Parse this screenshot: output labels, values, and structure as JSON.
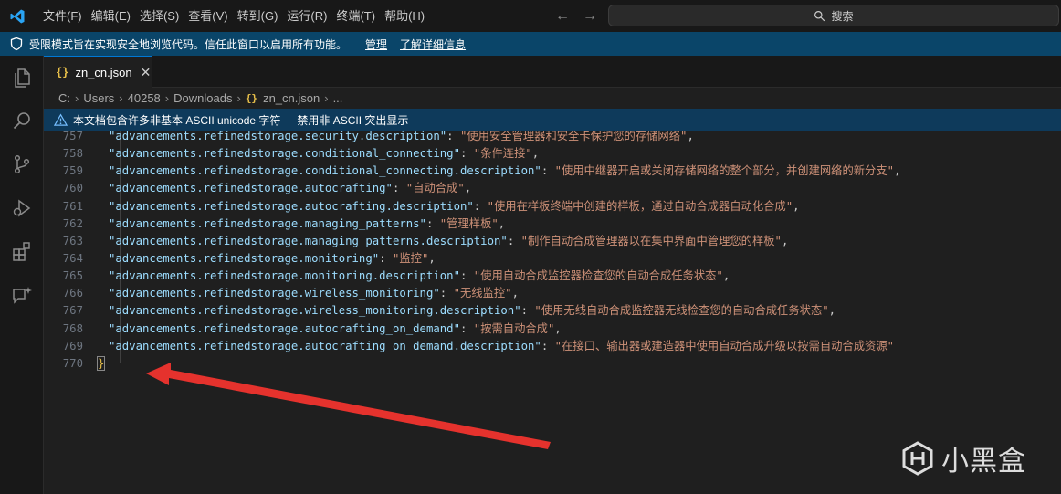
{
  "menu": [
    "文件(F)",
    "编辑(E)",
    "选择(S)",
    "查看(V)",
    "转到(G)",
    "运行(R)",
    "终端(T)",
    "帮助(H)"
  ],
  "search": {
    "label": "搜索"
  },
  "banner": {
    "text": "受限模式旨在实现安全地浏览代码。信任此窗口以启用所有功能。",
    "manage": "管理",
    "learn_more": "了解详细信息"
  },
  "tab": {
    "icon": "{}",
    "label": "zn_cn.json",
    "close": "✕"
  },
  "breadcrumb": [
    "C:",
    "Users",
    "40258",
    "Downloads",
    "zn_cn.json",
    "..."
  ],
  "breadcrumb_icon": "{}",
  "unicode_warning": {
    "text": "本文档包含许多非基本 ASCII unicode 字符",
    "action": "禁用非 ASCII 突出显示"
  },
  "code_lines": [
    {
      "num": "757",
      "key": "\"advancements.refinedstorage.security.description\"",
      "sep": ": ",
      "val": "\"使用安全管理器和安全卡保护您的存储网络\"",
      "end": ","
    },
    {
      "num": "758",
      "key": "\"advancements.refinedstorage.conditional_connecting\"",
      "sep": ": ",
      "val": "\"条件连接\"",
      "end": ","
    },
    {
      "num": "759",
      "key": "\"advancements.refinedstorage.conditional_connecting.description\"",
      "sep": ": ",
      "val": "\"使用中继器开启或关闭存储网络的整个部分，并创建网络的新分支\"",
      "end": ","
    },
    {
      "num": "760",
      "key": "\"advancements.refinedstorage.autocrafting\"",
      "sep": ": ",
      "val": "\"自动合成\"",
      "end": ","
    },
    {
      "num": "761",
      "key": "\"advancements.refinedstorage.autocrafting.description\"",
      "sep": ": ",
      "val": "\"使用在样板终端中创建的样板，通过自动合成器自动化合成\"",
      "end": ","
    },
    {
      "num": "762",
      "key": "\"advancements.refinedstorage.managing_patterns\"",
      "sep": ": ",
      "val": "\"管理样板\"",
      "end": ","
    },
    {
      "num": "763",
      "key": "\"advancements.refinedstorage.managing_patterns.description\"",
      "sep": ": ",
      "val": "\"制作自动合成管理器以在集中界面中管理您的样板\"",
      "end": ","
    },
    {
      "num": "764",
      "key": "\"advancements.refinedstorage.monitoring\"",
      "sep": ": ",
      "val": "\"监控\"",
      "end": ","
    },
    {
      "num": "765",
      "key": "\"advancements.refinedstorage.monitoring.description\"",
      "sep": ": ",
      "val": "\"使用自动合成监控器检查您的自动合成任务状态\"",
      "end": ","
    },
    {
      "num": "766",
      "key": "\"advancements.refinedstorage.wireless_monitoring\"",
      "sep": ": ",
      "val": "\"无线监控\"",
      "end": ","
    },
    {
      "num": "767",
      "key": "\"advancements.refinedstorage.wireless_monitoring.description\"",
      "sep": ": ",
      "val": "\"使用无线自动合成监控器无线检查您的自动合成任务状态\"",
      "end": ","
    },
    {
      "num": "768",
      "key": "\"advancements.refinedstorage.autocrafting_on_demand\"",
      "sep": ": ",
      "val": "\"按需自动合成\"",
      "end": ","
    },
    {
      "num": "769",
      "key": "\"advancements.refinedstorage.autocrafting_on_demand.description\"",
      "sep": ": ",
      "val": "\"在接口、输出器或建造器中使用自动合成升级以按需自动合成资源\"",
      "end": ""
    }
  ],
  "last_line": {
    "num": "770",
    "text": "}"
  },
  "watermark": {
    "text": "小黑盒"
  },
  "colors": {
    "accent": "#0078d4",
    "banner_bg": "#0a4569",
    "key": "#9cdcfe",
    "string": "#ce9178",
    "arrow": "#e5322d"
  }
}
